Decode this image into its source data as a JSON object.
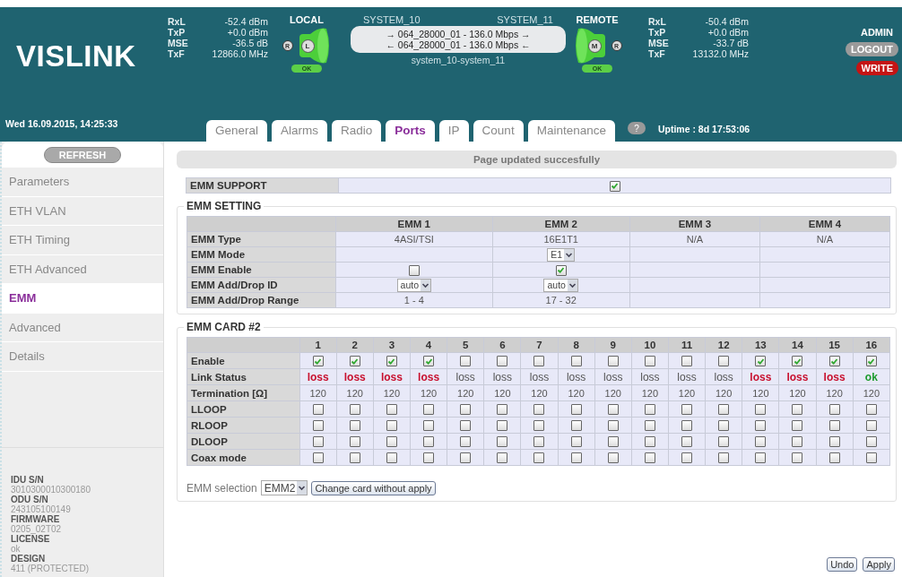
{
  "header": {
    "brand": "VISLINK",
    "datetime": "Wed 16.09.2015, 14:25:33",
    "local": {
      "stats": [
        {
          "label": "RxL",
          "value": "-52.4 dBm"
        },
        {
          "label": "TxP",
          "value": "+0.0 dBm"
        },
        {
          "label": "MSE",
          "value": "-36.5 dB"
        },
        {
          "label": "TxF",
          "value": "12866.0 MHz"
        }
      ],
      "title": "LOCAL",
      "outer_badge": "R",
      "inner_badge": "L",
      "status": "OK"
    },
    "link": {
      "left_system": "SYSTEM_10",
      "right_system": "SYSTEM_11",
      "lines": [
        "→ 064_28000_01 - 136.0 Mbps →",
        "← 064_28000_01 - 136.0 Mbps ←"
      ],
      "name": "system_10-system_11"
    },
    "remote": {
      "title": "REMOTE",
      "inner_badge": "M",
      "outer_badge": "R",
      "status": "OK",
      "stats": [
        {
          "label": "RxL",
          "value": "-50.4 dBm"
        },
        {
          "label": "TxP",
          "value": "+0.0 dBm"
        },
        {
          "label": "MSE",
          "value": "-33.7 dB"
        },
        {
          "label": "TxF",
          "value": "13132.0 MHz"
        }
      ]
    },
    "user": {
      "role": "ADMIN",
      "logout": "LOGOUT",
      "write": "WRITE"
    },
    "tabs": [
      {
        "label": "General",
        "selected": false
      },
      {
        "label": "Alarms",
        "selected": false
      },
      {
        "label": "Radio",
        "selected": false
      },
      {
        "label": "Ports",
        "selected": true
      },
      {
        "label": "IP",
        "selected": false
      },
      {
        "label": "Count",
        "selected": false
      },
      {
        "label": "Maintenance",
        "selected": false
      }
    ],
    "help": "?",
    "uptime": "Uptime : 8d 17:53:06"
  },
  "sidebar": {
    "refresh": "REFRESH",
    "items": [
      {
        "label": "Parameters",
        "selected": false
      },
      {
        "label": "ETH VLAN",
        "selected": false
      },
      {
        "label": "ETH Timing",
        "selected": false
      },
      {
        "label": "ETH Advanced",
        "selected": false
      },
      {
        "label": "EMM",
        "selected": true
      },
      {
        "label": "Advanced",
        "selected": false
      },
      {
        "label": "Details",
        "selected": false
      }
    ],
    "info": [
      {
        "label": "IDU S/N",
        "value": "3010300010300180"
      },
      {
        "label": "ODU S/N",
        "value": "243105100149"
      },
      {
        "label": "FIRMWARE",
        "value": "0205_02T02"
      },
      {
        "label": "LICENSE",
        "value": "ok"
      },
      {
        "label": "DESIGN",
        "value": "411 (PROTECTED)"
      }
    ]
  },
  "status_message": "Page updated succesfully",
  "emm_support": {
    "label": "EMM SUPPORT",
    "checked": true
  },
  "emm_setting": {
    "title": "EMM SETTING",
    "columns": [
      "EMM 1",
      "EMM 2",
      "EMM 3",
      "EMM 4"
    ],
    "rows": [
      {
        "label": "EMM Type",
        "cells": [
          {
            "kind": "text",
            "text": "4ASI/TSI"
          },
          {
            "kind": "text",
            "text": "16E1T1"
          },
          {
            "kind": "text",
            "text": "N/A"
          },
          {
            "kind": "text",
            "text": "N/A"
          }
        ]
      },
      {
        "label": "EMM Mode",
        "cells": [
          {
            "kind": "empty"
          },
          {
            "kind": "select",
            "value": "E1"
          },
          {
            "kind": "empty"
          },
          {
            "kind": "empty"
          }
        ]
      },
      {
        "label": "EMM Enable",
        "cells": [
          {
            "kind": "checkbox",
            "checked": false
          },
          {
            "kind": "checkbox",
            "checked": true
          },
          {
            "kind": "empty"
          },
          {
            "kind": "empty"
          }
        ]
      },
      {
        "label": "EMM Add/Drop ID",
        "cells": [
          {
            "kind": "select",
            "value": "auto"
          },
          {
            "kind": "select",
            "value": "auto"
          },
          {
            "kind": "empty"
          },
          {
            "kind": "empty"
          }
        ]
      },
      {
        "label": "EMM Add/Drop Range",
        "cells": [
          {
            "kind": "text",
            "text": "1 - 4"
          },
          {
            "kind": "text",
            "text": "17 - 32"
          },
          {
            "kind": "empty"
          },
          {
            "kind": "empty"
          }
        ]
      }
    ]
  },
  "emm_card": {
    "title": "EMM CARD #2",
    "columns": [
      "1",
      "2",
      "3",
      "4",
      "5",
      "6",
      "7",
      "8",
      "9",
      "10",
      "11",
      "12",
      "13",
      "14",
      "15",
      "16"
    ],
    "rows": [
      {
        "label": "Enable",
        "kind": "checkbox",
        "cells": [
          true,
          true,
          true,
          true,
          false,
          false,
          false,
          false,
          false,
          false,
          false,
          false,
          true,
          true,
          true,
          true
        ]
      },
      {
        "label": "Link Status",
        "kind": "status",
        "cells": [
          {
            "text": "loss",
            "color": "#c8102e",
            "active": true
          },
          {
            "text": "loss",
            "color": "#c8102e",
            "active": true
          },
          {
            "text": "loss",
            "color": "#c8102e",
            "active": true
          },
          {
            "text": "loss",
            "color": "#c8102e",
            "active": true
          },
          {
            "text": "loss",
            "color": "#555555",
            "active": false
          },
          {
            "text": "loss",
            "color": "#555555",
            "active": false
          },
          {
            "text": "loss",
            "color": "#555555",
            "active": false
          },
          {
            "text": "loss",
            "color": "#555555",
            "active": false
          },
          {
            "text": "loss",
            "color": "#555555",
            "active": false
          },
          {
            "text": "loss",
            "color": "#555555",
            "active": false
          },
          {
            "text": "loss",
            "color": "#555555",
            "active": false
          },
          {
            "text": "loss",
            "color": "#555555",
            "active": false
          },
          {
            "text": "loss",
            "color": "#c8102e",
            "active": true
          },
          {
            "text": "loss",
            "color": "#c8102e",
            "active": true
          },
          {
            "text": "loss",
            "color": "#c8102e",
            "active": true
          },
          {
            "text": "ok",
            "color": "#1d9a2d",
            "active": true
          }
        ]
      },
      {
        "label": "Termination [Ω]",
        "kind": "text",
        "cells": [
          "120",
          "120",
          "120",
          "120",
          "120",
          "120",
          "120",
          "120",
          "120",
          "120",
          "120",
          "120",
          "120",
          "120",
          "120",
          "120"
        ]
      },
      {
        "label": "LLOOP",
        "kind": "checkbox",
        "cells": [
          false,
          false,
          false,
          false,
          false,
          false,
          false,
          false,
          false,
          false,
          false,
          false,
          false,
          false,
          false,
          false
        ]
      },
      {
        "label": "RLOOP",
        "kind": "checkbox",
        "cells": [
          false,
          false,
          false,
          false,
          false,
          false,
          false,
          false,
          false,
          false,
          false,
          false,
          false,
          false,
          false,
          false
        ]
      },
      {
        "label": "DLOOP",
        "kind": "checkbox",
        "cells": [
          false,
          false,
          false,
          false,
          false,
          false,
          false,
          false,
          false,
          false,
          false,
          false,
          false,
          false,
          false,
          false
        ]
      },
      {
        "label": "Coax mode",
        "kind": "checkbox",
        "cells": [
          false,
          false,
          false,
          false,
          false,
          false,
          false,
          false,
          false,
          false,
          false,
          false,
          false,
          false,
          false,
          false
        ]
      }
    ],
    "selection_label": "EMM selection",
    "selection_value": "EMM2",
    "change_button": "Change card without apply"
  },
  "buttons": [
    "Undo",
    "Apply"
  ]
}
